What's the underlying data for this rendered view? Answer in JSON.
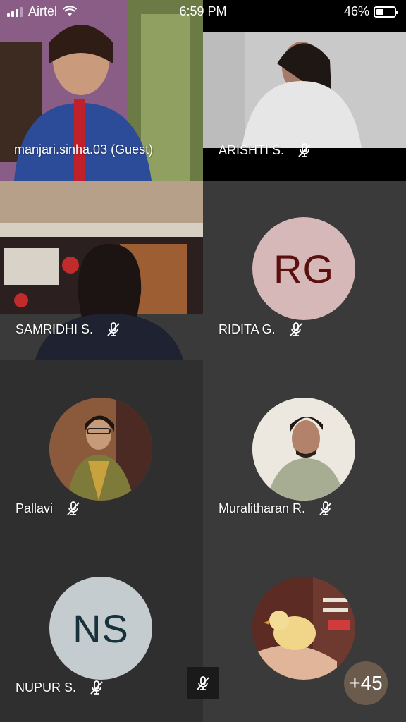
{
  "status_bar": {
    "carrier": "Airtel",
    "time": "6:59 PM",
    "battery": "46%",
    "battery_level": 0.46
  },
  "participants": [
    {
      "name": "manjari.sinha.03 (Guest)",
      "muted": false,
      "type": "video"
    },
    {
      "name": "ARISHTI S.",
      "muted": true,
      "type": "video"
    },
    {
      "name": "SAMRIDHI S.",
      "muted": true,
      "type": "video"
    },
    {
      "name": "RIDITA G.",
      "muted": true,
      "type": "initials",
      "initials": "RG",
      "avatar_color": "#d7b8b8",
      "text_color": "#5b1010"
    },
    {
      "name": "Pallavi",
      "muted": true,
      "type": "photo"
    },
    {
      "name": "Muralitharan R.",
      "muted": true,
      "type": "photo"
    },
    {
      "name": "NUPUR S.",
      "muted": true,
      "type": "initials",
      "initials": "NS",
      "avatar_color": "#c5ccd0",
      "text_color": "#17323a"
    },
    {
      "name": "",
      "muted": false,
      "type": "photo"
    }
  ],
  "overflow_count": "+45",
  "colors": {
    "tile_dark": "#2f2f2f",
    "tile_mid": "#3a3a3a"
  }
}
